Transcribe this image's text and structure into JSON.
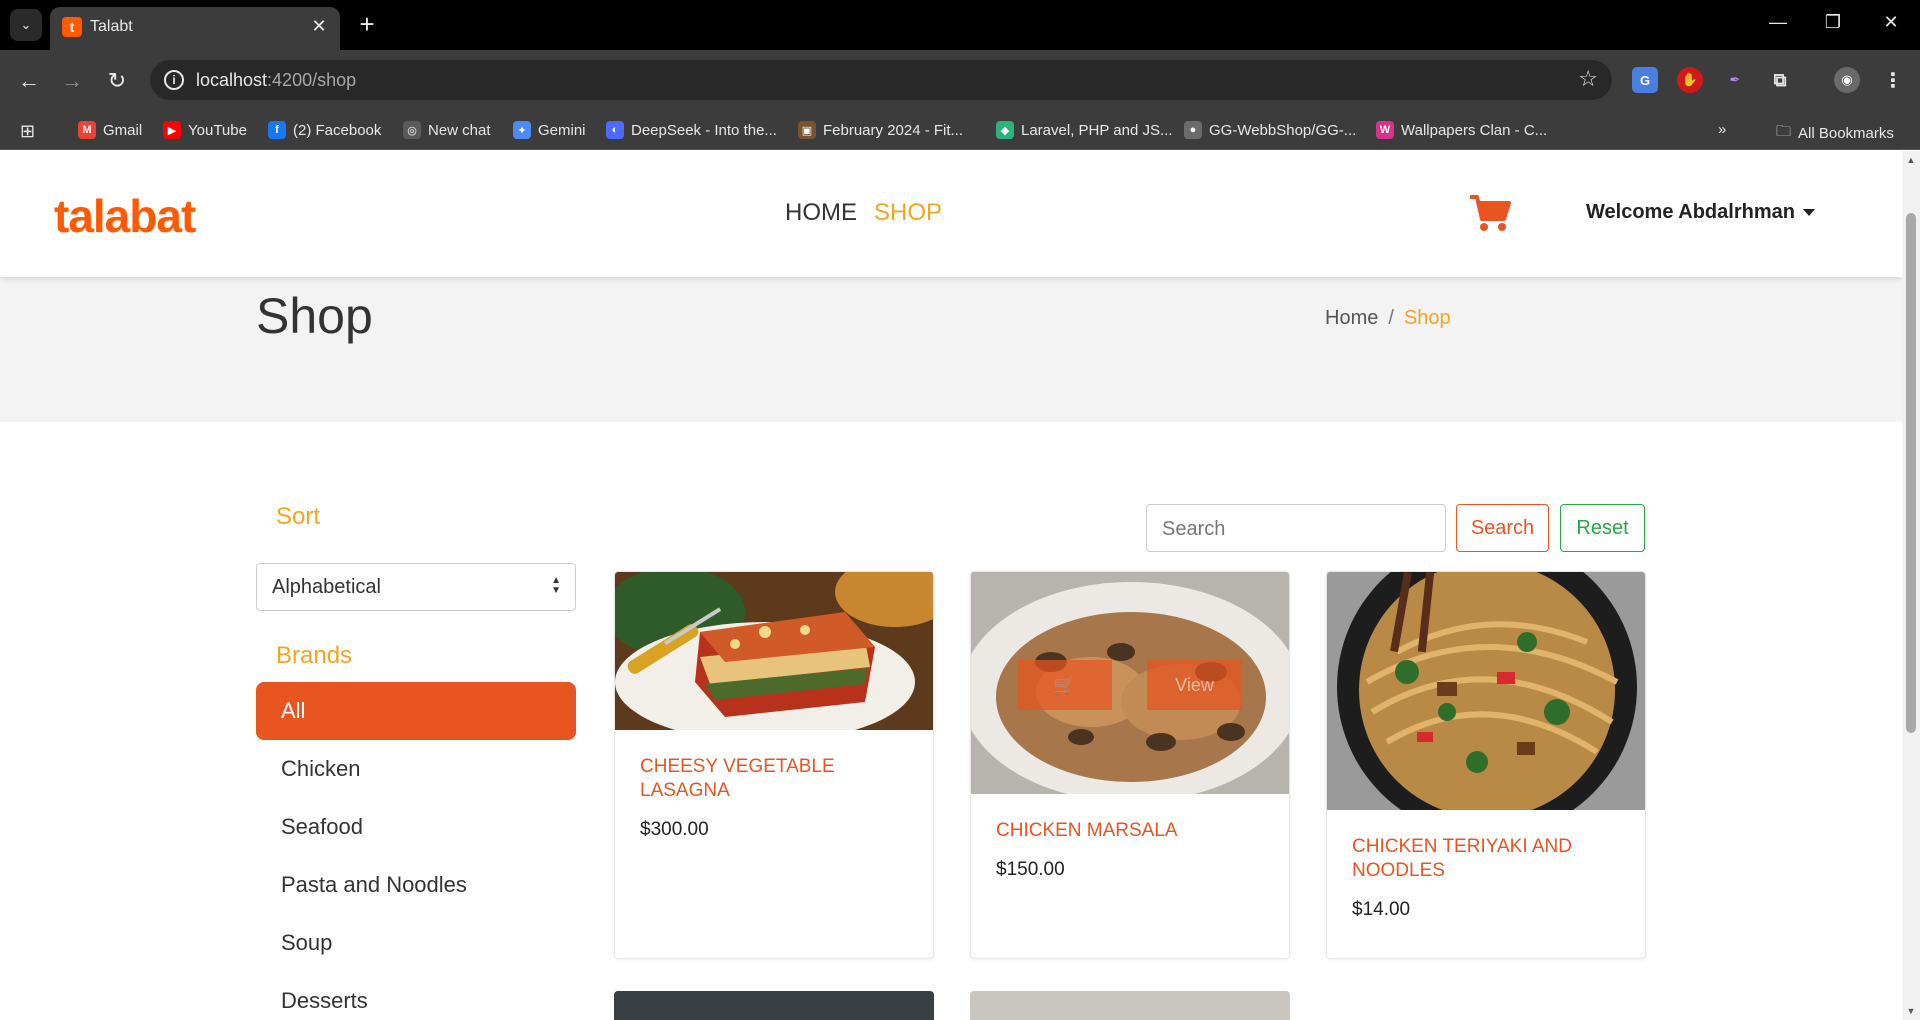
{
  "browser": {
    "tab_title": "Talabt",
    "tab_favicon_letter": "t",
    "url_host": "localhost",
    "url_path": ":4200/shop",
    "bookmarks": [
      {
        "label": "Gmail",
        "icon": "gmail-icon",
        "color": "#ea4335",
        "glyph": "M"
      },
      {
        "label": "YouTube",
        "icon": "youtube-icon",
        "color": "#ff0000",
        "glyph": "▶"
      },
      {
        "label": "(2) Facebook",
        "icon": "facebook-icon",
        "color": "#1877f2",
        "glyph": "f"
      },
      {
        "label": "New chat",
        "icon": "openai-icon",
        "color": "#5a5a5a",
        "glyph": "◎"
      },
      {
        "label": "Gemini",
        "icon": "gemini-icon",
        "color": "#4b8bf5",
        "glyph": "✦"
      },
      {
        "label": "DeepSeek - Into the...",
        "icon": "deepseek-icon",
        "color": "#4d6bfe",
        "glyph": "◐"
      },
      {
        "label": "February 2024 - Fit...",
        "icon": "fitness-icon",
        "color": "#7a5230",
        "glyph": "▣"
      },
      {
        "label": "Laravel, PHP and JS...",
        "icon": "laracasts-icon",
        "color": "#2fb17b",
        "glyph": "◆"
      },
      {
        "label": "GG-WebbShop/GG-...",
        "icon": "github-icon",
        "color": "#6b6b6b",
        "glyph": "●"
      },
      {
        "label": "Wallpapers Clan - C...",
        "icon": "wallpapers-icon",
        "color": "#d6338c",
        "glyph": "W"
      }
    ],
    "all_bookmarks_label": "All Bookmarks",
    "colors": {
      "chrome_dark": "#000000",
      "chrome_toolbar": "#3c3c3c"
    }
  },
  "site": {
    "logo": "talabat",
    "nav": [
      "HOME",
      "SHOP"
    ],
    "active_nav": "SHOP",
    "user_menu": "Welcome Abdalrhman",
    "colors": {
      "brand_orange": "#ff5a00",
      "accent_gold": "#f3a521",
      "button_orange": "#e85520",
      "reset_green": "#28a745"
    }
  },
  "banner": {
    "title": "Shop",
    "breadcrumb": [
      "Home",
      "/",
      "Shop"
    ]
  },
  "sidebar": {
    "sort_title": "Sort",
    "sort_value": "Alphabetical",
    "brands_title": "Brands",
    "brands": [
      "All",
      "Chicken",
      "Seafood",
      "Pasta and Noodles",
      "Soup",
      "Desserts"
    ],
    "active_brand": "All"
  },
  "search": {
    "placeholder": "Search",
    "search_label": "Search",
    "reset_label": "Reset"
  },
  "products": [
    {
      "name": "CHEESY VEGETABLE LASAGNA",
      "price": "$300.00",
      "image": "lasagna-photo"
    },
    {
      "name": "CHICKEN MARSALA",
      "price": "$150.00",
      "image": "chicken-marsala-photo",
      "overlay_buttons": [
        "🛒",
        "View"
      ]
    },
    {
      "name": "CHICKEN TERIYAKI AND NOODLES",
      "price": "$14.00",
      "image": "teriyaki-noodles-photo"
    }
  ]
}
